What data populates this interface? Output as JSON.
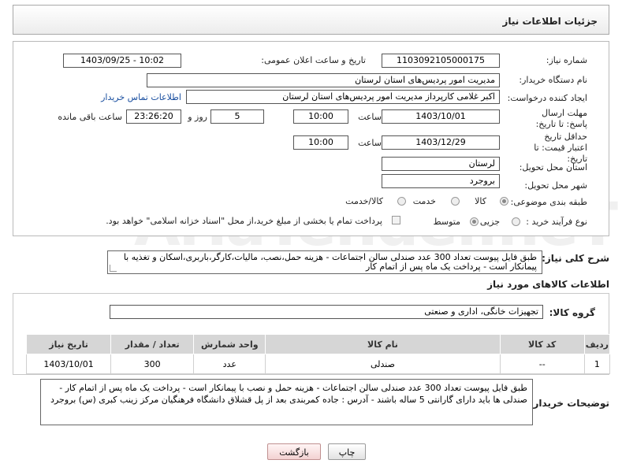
{
  "header": {
    "title": "جزئیات اطلاعات نیاز"
  },
  "form": {
    "need_number_label": "شماره نیاز:",
    "need_number": "1103092105000175",
    "announce_label": "تاریخ و ساعت اعلان عمومی:",
    "announce_value": "1403/09/25 - 10:02",
    "buyer_org_label": "نام دستگاه خریدار:",
    "buyer_org": "مدیریت امور پردیس‌های استان لرستان",
    "creator_label": "ایجاد کننده درخواست:",
    "creator": "اکبر غلامی کارپرداز مدیریت امور پردیس‌های استان لرستان",
    "contact_link": "اطلاعات تماس خریدار",
    "deadline_label": "مهلت ارسال پاسخ: تا تاریخ:",
    "deadline_date": "1403/10/01",
    "time_label": "ساعت",
    "deadline_time": "10:00",
    "days_value": "5",
    "days_label": "روز و",
    "remaining_time": "23:26:20",
    "remaining_label": "ساعت باقی مانده",
    "validity_label": "حداقل تاریخ اعتبار قیمت: تا تاریخ:",
    "validity_date": "1403/12/29",
    "validity_time": "10:00",
    "province_label": "استان محل تحویل:",
    "province": "لرستان",
    "city_label": "شهر محل تحویل:",
    "city": "بروجرد",
    "category_label": "طبقه بندی موضوعی:",
    "category_options": [
      "کالا",
      "خدمت",
      "کالا/خدمت"
    ],
    "process_label": "نوع فرآیند خرید :",
    "process_options": [
      "جزیی",
      "متوسط"
    ],
    "payment_note": "پرداخت تمام یا بخشی از مبلغ خرید،از محل \"اسناد خزانه اسلامی\" خواهد بود."
  },
  "summary": {
    "label": "شرح کلی نیاز:",
    "text": "طبق فایل پیوست تعداد 300 عدد صندلی سالن اجتماعات - هزینه حمل،نصب، مالیات،کارگر،باربری،اسکان و تغذیه با پیمانکار است - پرداخت یک ماه پس از اتمام کار"
  },
  "goods": {
    "section_title": "اطلاعات کالاهای مورد نیاز",
    "group_label": "گروه کالا:",
    "group_value": "تجهیزات خانگی، اداری و صنعتی",
    "columns": [
      "ردیف",
      "کد کالا",
      "نام کالا",
      "واحد شمارش",
      "تعداد / مقدار",
      "تاریخ نیاز"
    ],
    "rows": [
      [
        "1",
        "--",
        "صندلی",
        "عدد",
        "300",
        "1403/10/01"
      ]
    ]
  },
  "buyer_notes": {
    "label": "توضیحات خریدار:",
    "text": "طبق فایل پیوست تعداد 300 عدد صندلی سالن اجتماعات - هزینه حمل و نصب با پیمانکار است - پرداخت یک ماه پس از اتمام کار - صندلی ها باید دارای گارانتی 5 ساله باشند - آدرس : جاده کمربندی بعد از پل قشلاق دانشگاه فرهنگیان مرکز زینب کبری (س) بروجرد"
  },
  "buttons": {
    "print": "چاپ",
    "back": "بازگشت"
  },
  "colors": {
    "link": "#1a4fa0",
    "table_header": "#d6d6d6",
    "back_button": "#f3d2d2"
  }
}
